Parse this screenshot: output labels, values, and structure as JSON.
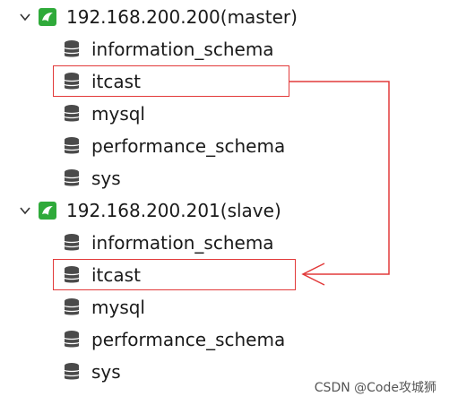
{
  "tree": {
    "connections": [
      {
        "label": "192.168.200.200(master)",
        "databases": [
          "information_schema",
          "itcast",
          "mysql",
          "performance_schema",
          "sys"
        ]
      },
      {
        "label": "192.168.200.201(slave)",
        "databases": [
          "information_schema",
          "itcast",
          "mysql",
          "performance_schema",
          "sys"
        ]
      }
    ]
  },
  "icons": {
    "expand": "chevron-down-icon",
    "connection": "mysql-connection-icon",
    "database": "database-icon"
  },
  "colors": {
    "connection_icon": "#2faa3a",
    "database_icon": "#4a4a4a",
    "highlight": "#e23a3a"
  },
  "watermark": "CSDN @Code攻城狮"
}
